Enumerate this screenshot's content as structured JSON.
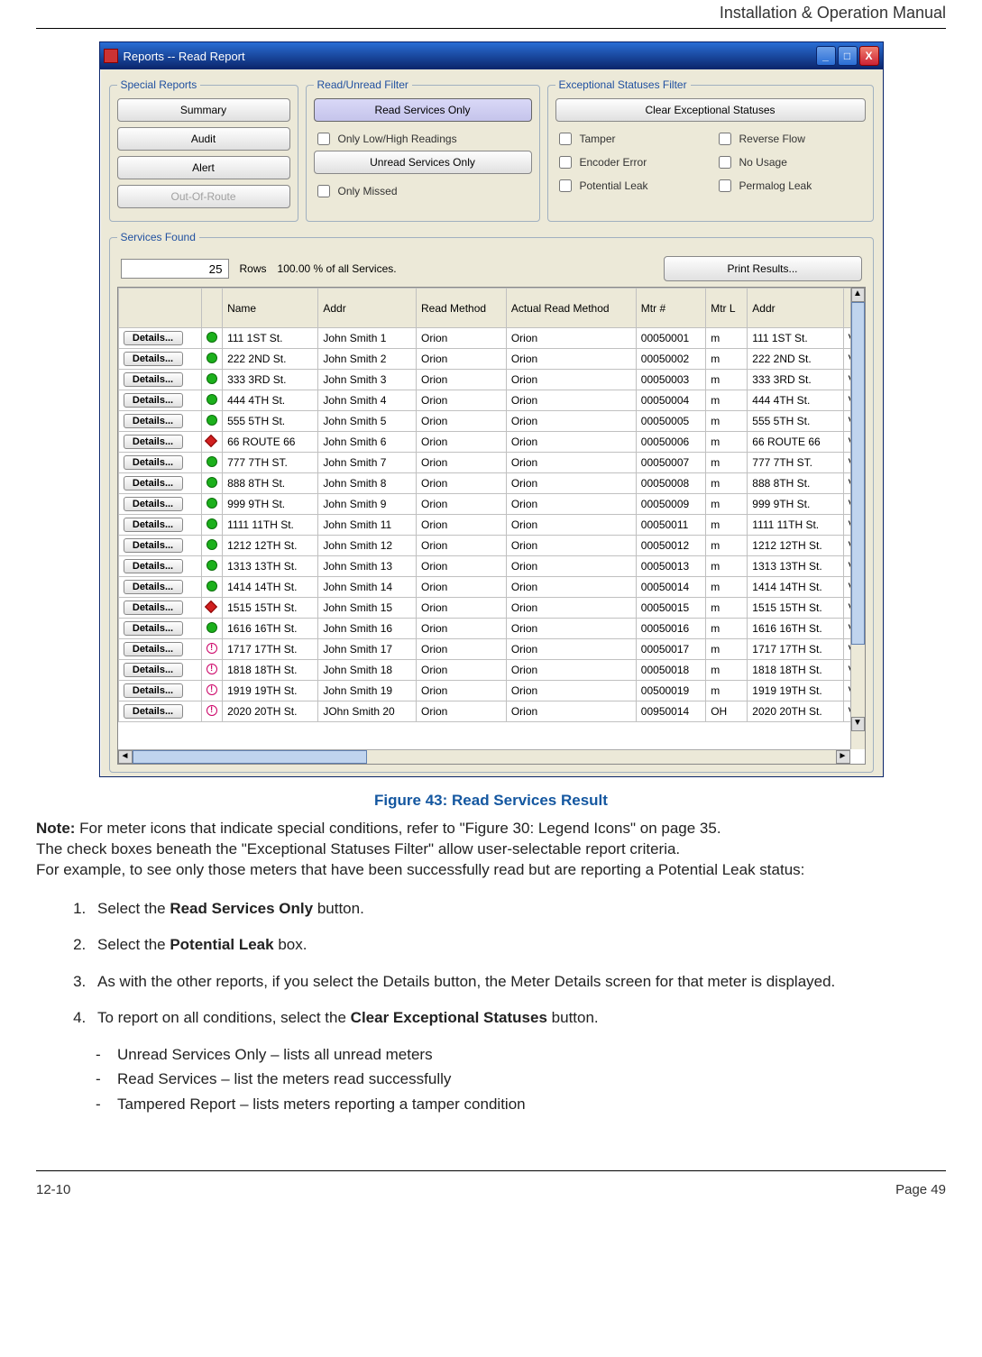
{
  "header": {
    "title": "Installation & Operation Manual"
  },
  "window": {
    "title": "Reports  -- Read Report",
    "controls": {
      "min": "_",
      "max": "□",
      "close": "X"
    }
  },
  "special_reports": {
    "legend": "Special Reports",
    "buttons": [
      "Summary",
      "Audit",
      "Alert",
      "Out-Of-Route"
    ]
  },
  "read_filter": {
    "legend": "Read/Unread Filter",
    "read_only": "Read Services Only",
    "low_high": "Only Low/High Readings",
    "unread_only": "Unread Services Only",
    "only_missed": "Only Missed"
  },
  "except_filter": {
    "legend": "Exceptional Statuses Filter",
    "clear": "Clear Exceptional Statuses",
    "tamper": "Tamper",
    "reverse": "Reverse Flow",
    "encoder": "Encoder Error",
    "nousage": "No Usage",
    "leak": "Potential Leak",
    "permalog": "Permalog Leak"
  },
  "services_found": {
    "legend": "Services Found",
    "count": "25",
    "rows_label": "Rows",
    "pct_label": "100.00 % of all Services.",
    "print": "Print Results..."
  },
  "grid": {
    "headers": [
      "",
      "",
      "Name",
      "Addr",
      "Read Method",
      "Actual Read Method",
      "Mtr #",
      "Mtr L",
      "Addr",
      ""
    ],
    "details_label": "Details...",
    "rows": [
      {
        "s": "green",
        "name": "111 1ST St.",
        "addr": "John Smith 1",
        "rm": "Orion",
        "arm": "Orion",
        "mtr": "00050001",
        "ml": "m",
        "addr2": "111 1ST St.",
        "x": "V"
      },
      {
        "s": "green",
        "name": "222 2ND St.",
        "addr": "John Smith 2",
        "rm": "Orion",
        "arm": "Orion",
        "mtr": "00050002",
        "ml": "m",
        "addr2": "222 2ND St.",
        "x": "V"
      },
      {
        "s": "green",
        "name": "333 3RD St.",
        "addr": "John Smith 3",
        "rm": "Orion",
        "arm": "Orion",
        "mtr": "00050003",
        "ml": "m",
        "addr2": "333 3RD St.",
        "x": "V"
      },
      {
        "s": "green",
        "name": "444 4TH St.",
        "addr": "John Smith 4",
        "rm": "Orion",
        "arm": "Orion",
        "mtr": "00050004",
        "ml": "m",
        "addr2": "444 4TH St.",
        "x": "V"
      },
      {
        "s": "green",
        "name": "555 5TH St.",
        "addr": "John Smith 5",
        "rm": "Orion",
        "arm": "Orion",
        "mtr": "00050005",
        "ml": "m",
        "addr2": "555 5TH St.",
        "x": "V"
      },
      {
        "s": "red",
        "name": "66 ROUTE 66",
        "addr": "John Smith 6",
        "rm": "Orion",
        "arm": "Orion",
        "mtr": "00050006",
        "ml": "m",
        "addr2": "66 ROUTE 66",
        "x": "V"
      },
      {
        "s": "green",
        "name": "777 7TH ST.",
        "addr": "John Smith 7",
        "rm": "Orion",
        "arm": "Orion",
        "mtr": "00050007",
        "ml": "m",
        "addr2": "777 7TH ST.",
        "x": "V"
      },
      {
        "s": "green",
        "name": "888 8TH St.",
        "addr": "John Smith 8",
        "rm": "Orion",
        "arm": "Orion",
        "mtr": "00050008",
        "ml": "m",
        "addr2": "888 8TH St.",
        "x": "V"
      },
      {
        "s": "green",
        "name": "999 9TH St.",
        "addr": "John Smith 9",
        "rm": "Orion",
        "arm": "Orion",
        "mtr": "00050009",
        "ml": "m",
        "addr2": "999 9TH St.",
        "x": "V"
      },
      {
        "s": "green",
        "name": "1111 11TH St.",
        "addr": "John Smith 11",
        "rm": "Orion",
        "arm": "Orion",
        "mtr": "00050011",
        "ml": "m",
        "addr2": "1111 11TH St.",
        "x": "V"
      },
      {
        "s": "green",
        "name": "1212 12TH St.",
        "addr": "John Smith 12",
        "rm": "Orion",
        "arm": "Orion",
        "mtr": "00050012",
        "ml": "m",
        "addr2": "1212 12TH St.",
        "x": "V"
      },
      {
        "s": "green",
        "name": "1313 13TH St.",
        "addr": "John Smith 13",
        "rm": "Orion",
        "arm": "Orion",
        "mtr": "00050013",
        "ml": "m",
        "addr2": "1313 13TH St.",
        "x": "V"
      },
      {
        "s": "green",
        "name": "1414 14TH St.",
        "addr": "John Smith 14",
        "rm": "Orion",
        "arm": "Orion",
        "mtr": "00050014",
        "ml": "m",
        "addr2": "1414 14TH St.",
        "x": "V"
      },
      {
        "s": "red",
        "name": "1515 15TH St.",
        "addr": "John Smith 15",
        "rm": "Orion",
        "arm": "Orion",
        "mtr": "00050015",
        "ml": "m",
        "addr2": "1515 15TH St.",
        "x": "V"
      },
      {
        "s": "green",
        "name": "1616 16TH St.",
        "addr": "John Smith 16",
        "rm": "Orion",
        "arm": "Orion",
        "mtr": "00050016",
        "ml": "m",
        "addr2": "1616 16TH St.",
        "x": "V"
      },
      {
        "s": "alert",
        "name": "1717 17TH St.",
        "addr": "John Smith 17",
        "rm": "Orion",
        "arm": "Orion",
        "mtr": "00050017",
        "ml": "m",
        "addr2": "1717 17TH St.",
        "x": "V"
      },
      {
        "s": "alert",
        "name": "1818 18TH St.",
        "addr": "John Smith 18",
        "rm": "Orion",
        "arm": "Orion",
        "mtr": "00050018",
        "ml": "m",
        "addr2": "1818 18TH St.",
        "x": "V"
      },
      {
        "s": "alert",
        "name": "1919 19TH St.",
        "addr": "John Smith 19",
        "rm": "Orion",
        "arm": "Orion",
        "mtr": "00500019",
        "ml": "m",
        "addr2": "1919 19TH St.",
        "x": "V"
      },
      {
        "s": "alert",
        "name": "2020 20TH St.",
        "addr": "JOhn Smith 20",
        "rm": "Orion",
        "arm": "Orion",
        "mtr": "00950014",
        "ml": "OH",
        "addr2": "2020 20TH St.",
        "x": "V"
      }
    ]
  },
  "caption": "Figure 43:  Read Services Result",
  "note": {
    "label": "Note:",
    "line1": " For meter icons that indicate special conditions, refer to \"Figure 30: Legend Icons\" on page 35.",
    "line2": "The check boxes beneath the \"Exceptional Statuses Filter\" allow user-selectable report criteria.",
    "line3": "For example, to see only those meters that have been successfully read but are reporting a Potential Leak status:"
  },
  "steps": {
    "s1a": "Select the ",
    "s1b": "Read Services Only",
    "s1c": " button.",
    "s2a": "Select the ",
    "s2b": "Potential Leak",
    "s2c": " box.",
    "s3": "As with the other reports, if you select the Details button, the  Meter Details screen for that meter is displayed.",
    "s4a": "To report on all conditions, select the ",
    "s4b": "Clear Exceptional Statuses",
    "s4c": " button."
  },
  "dashes": {
    "d1": "Unread Services Only – lists all unread meters",
    "d2": "Read Services – list the meters read successfully",
    "d3": "Tampered Report – lists meters reporting a tamper condition"
  },
  "footer": {
    "left": "12-10",
    "right": "Page 49"
  }
}
